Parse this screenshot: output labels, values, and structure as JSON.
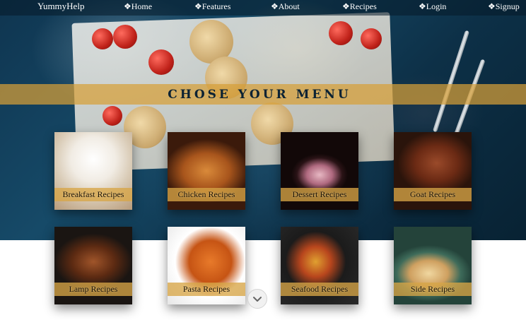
{
  "nav": {
    "brand": "YummyHelp",
    "items": [
      {
        "id": "home",
        "label": "❖Home"
      },
      {
        "id": "features",
        "label": "❖Features"
      },
      {
        "id": "about",
        "label": "❖About"
      },
      {
        "id": "recipes",
        "label": "❖Recipes"
      },
      {
        "id": "login",
        "label": "❖Login"
      },
      {
        "id": "signup",
        "label": "❖Signup"
      }
    ]
  },
  "banner": {
    "title": "CHOSE YOUR MENU"
  },
  "cards": [
    {
      "id": "breakfast",
      "label": "Breakfast Recipes"
    },
    {
      "id": "chicken",
      "label": "Chicken Recipes"
    },
    {
      "id": "dessert",
      "label": "Dessert Recipes"
    },
    {
      "id": "goat",
      "label": "Goat Recipes"
    },
    {
      "id": "lamp",
      "label": "Lamp Recipes"
    },
    {
      "id": "pasta",
      "label": "Pasta Recipes"
    },
    {
      "id": "seafood",
      "label": "Seafood Recipes"
    },
    {
      "id": "side",
      "label": "Side Recipes"
    }
  ],
  "scroll": {
    "icon": "chevron-down-icon"
  }
}
